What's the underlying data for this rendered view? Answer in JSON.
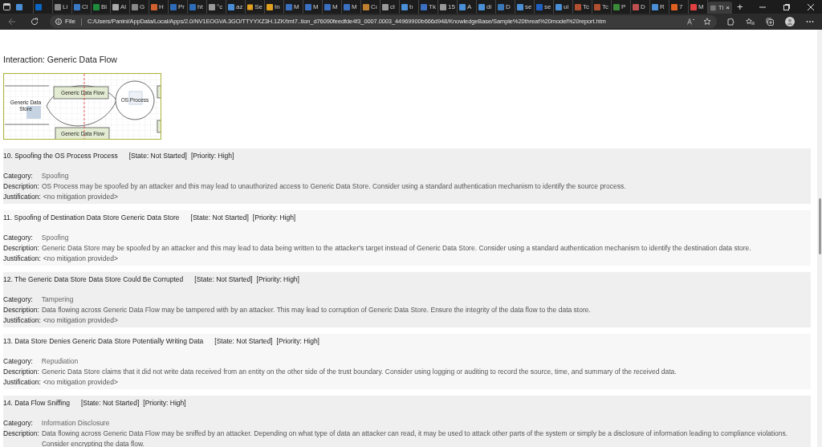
{
  "tabs": [
    {
      "selected": false
    },
    {
      "selected": false
    },
    {
      "label": "Li",
      "selected": false
    },
    {
      "label": "Cl",
      "selected": false
    },
    {
      "label": "Bi",
      "selected": false
    },
    {
      "label": "Al",
      "selected": false
    },
    {
      "label": "G",
      "selected": false
    },
    {
      "label": "H",
      "selected": false
    },
    {
      "label": "Pr",
      "selected": false
    },
    {
      "label": "ht",
      "selected": false
    },
    {
      "label": "°c",
      "selected": false
    },
    {
      "label": "az",
      "selected": false
    },
    {
      "label": "Se",
      "selected": false
    },
    {
      "label": "In",
      "selected": false
    },
    {
      "label": "M",
      "selected": false
    },
    {
      "label": "M",
      "selected": false
    },
    {
      "label": "M",
      "selected": false
    },
    {
      "label": "M",
      "selected": false
    },
    {
      "label": "Cı",
      "selected": false
    },
    {
      "label": "cl",
      "selected": false
    },
    {
      "label": "tı",
      "selected": false
    },
    {
      "label": "Tk",
      "selected": false
    },
    {
      "label": "15",
      "selected": false
    },
    {
      "label": "A",
      "selected": false
    },
    {
      "label": "di",
      "selected": false
    },
    {
      "label": "D",
      "selected": false
    },
    {
      "label": "se",
      "selected": false
    },
    {
      "label": "se",
      "selected": false
    },
    {
      "label": "ui",
      "selected": false
    },
    {
      "label": "Tc",
      "selected": false
    },
    {
      "label": "Tc",
      "selected": false
    },
    {
      "label": "P",
      "selected": false
    },
    {
      "label": "D",
      "selected": false
    },
    {
      "label": "R",
      "selected": false
    },
    {
      "label": "7",
      "selected": false
    },
    {
      "label": "M",
      "selected": false
    },
    {
      "label": "Tl",
      "selected": true
    }
  ],
  "tab_close": "×",
  "new_tab": "+",
  "address_bar": {
    "scheme": "File",
    "url": "C:/Users/Panini/AppData/Local/Apps/2.0/NV1EOGVA.3GO/TTYYXZ3H.1ZK/tmt7..tion_d76090feedfde4f3_0007.0003_44969900b666d948/KnowledgeBase/Sample%20threat%20model%20report.htm"
  },
  "page": {
    "interaction_title": "Interaction: Generic Data Flow",
    "diagram": {
      "store": "Generic Data Store",
      "flow_top": "Generic Data Flow",
      "process": "OS Process",
      "flow_bottom": "Generic Data Flow"
    },
    "threats": [
      {
        "title": "10. Spoofing the OS Process Process",
        "state": "[State: Not Started]",
        "priority": "[Priority: High]",
        "category_label": "Category:",
        "category": "Spoofing",
        "description_label": "Description:",
        "justification_label": "Justification:",
        "description": "OS Process may be spoofed by an attacker and this may lead to unauthorized access to Generic Data Store. Consider using a standard authentication mechanism to identify the source process.",
        "justification": "<no mitigation provided>"
      },
      {
        "title": "11. Spoofing of Destination Data Store Generic Data Store",
        "state": "[State: Not Started]",
        "priority": "[Priority: High]",
        "category_label": "Category:",
        "category": "Spoofing",
        "description_label": "Description:",
        "justification_label": "Justification:",
        "description": "Generic Data Store may be spoofed by an attacker and this may lead to data being written to the attacker's target instead of Generic Data Store. Consider using a standard authentication mechanism to identify the destination data store.",
        "justification": "<no mitigation provided>"
      },
      {
        "title": "12. The Generic Data Store Data Store Could Be Corrupted",
        "state": "[State: Not Started]",
        "priority": "[Priority: High]",
        "category_label": "Category:",
        "category": "Tampering",
        "description_label": "Description:",
        "justification_label": "Justification:",
        "description": "Data flowing across Generic Data Flow may be tampered with by an attacker. This may lead to corruption of Generic Data Store. Ensure the integrity of the data flow to the data store.",
        "justification": "<no mitigation provided>"
      },
      {
        "title": "13. Data Store Denies Generic Data Store Potentially Writing Data",
        "state": "[State: Not Started]",
        "priority": "[Priority: High]",
        "category_label": "Category:",
        "category": "Repudiation",
        "description_label": "Description:",
        "justification_label": "Justification:",
        "description": "Generic Data Store claims that it did not write data received from an entity on the other side of the trust boundary. Consider using logging or auditing to record the source, time, and summary of the received data.",
        "justification": "<no mitigation provided>"
      },
      {
        "title": "14. Data Flow Sniffing",
        "state": "[State: Not Started]",
        "priority": "[Priority: High]",
        "category_label": "Category:",
        "category": "Information Disclosure",
        "description_label": "Description:",
        "description": "Data flowing across Generic Data Flow may be sniffed by an attacker. Depending on what type of data an attacker can read, it may be used to attack other parts of the system or simply be a disclosure of information leading to compliance violations. Consider encrypting the data flow."
      }
    ]
  }
}
